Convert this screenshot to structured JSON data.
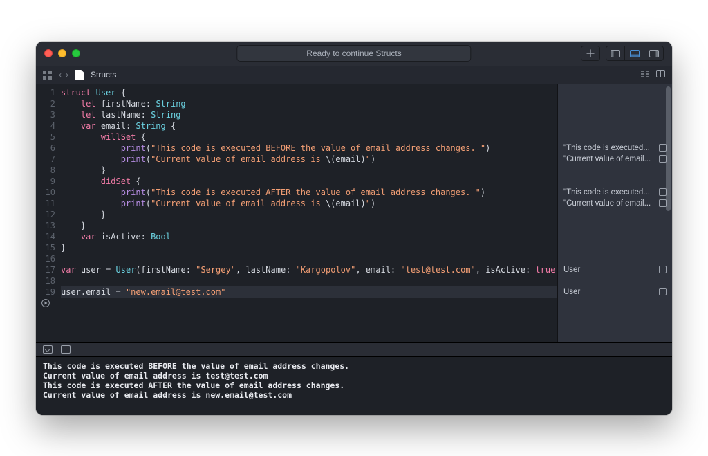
{
  "title": "Ready to continue Structs",
  "filename": "Structs",
  "code": {
    "lines": [
      {
        "n": 1,
        "tokens": [
          [
            "kw",
            "struct"
          ],
          [
            " "
          ],
          [
            "type",
            "User"
          ],
          [
            " "
          ],
          [
            "punc",
            "{"
          ]
        ]
      },
      {
        "n": 2,
        "tokens": [
          [
            "    "
          ],
          [
            "kw",
            "let"
          ],
          [
            " "
          ],
          [
            "ident",
            "firstName"
          ],
          [
            "punc",
            ": "
          ],
          [
            "type",
            "String"
          ]
        ]
      },
      {
        "n": 3,
        "tokens": [
          [
            "    "
          ],
          [
            "kw",
            "let"
          ],
          [
            " "
          ],
          [
            "ident",
            "lastName"
          ],
          [
            "punc",
            ": "
          ],
          [
            "type",
            "String"
          ]
        ]
      },
      {
        "n": 4,
        "tokens": [
          [
            "    "
          ],
          [
            "kw",
            "var"
          ],
          [
            " "
          ],
          [
            "ident",
            "email"
          ],
          [
            "punc",
            ": "
          ],
          [
            "type",
            "String"
          ],
          [
            " "
          ],
          [
            "punc",
            "{"
          ]
        ]
      },
      {
        "n": 5,
        "tokens": [
          [
            "        "
          ],
          [
            "kw",
            "willSet"
          ],
          [
            " "
          ],
          [
            "punc",
            "{"
          ]
        ]
      },
      {
        "n": 6,
        "tokens": [
          [
            "            "
          ],
          [
            "fn",
            "print"
          ],
          [
            "paren",
            "("
          ],
          [
            "str",
            "\"This code is executed BEFORE the value of email address changes. \""
          ],
          [
            "paren",
            ")"
          ]
        ]
      },
      {
        "n": 7,
        "tokens": [
          [
            "            "
          ],
          [
            "fn",
            "print"
          ],
          [
            "paren",
            "("
          ],
          [
            "str",
            "\"Current value of email address is "
          ],
          [
            "interp",
            "\\("
          ],
          [
            "ident",
            "email"
          ],
          [
            "interp",
            ")"
          ],
          [
            "str",
            "\""
          ],
          [
            "paren",
            ")"
          ]
        ]
      },
      {
        "n": 8,
        "tokens": [
          [
            "        "
          ],
          [
            "punc",
            "}"
          ]
        ]
      },
      {
        "n": 9,
        "tokens": [
          [
            "        "
          ],
          [
            "kw",
            "didSet"
          ],
          [
            " "
          ],
          [
            "punc",
            "{"
          ]
        ]
      },
      {
        "n": 10,
        "tokens": [
          [
            "            "
          ],
          [
            "fn",
            "print"
          ],
          [
            "paren",
            "("
          ],
          [
            "str",
            "\"This code is executed AFTER the value of email address changes. \""
          ],
          [
            "paren",
            ")"
          ]
        ]
      },
      {
        "n": 11,
        "tokens": [
          [
            "            "
          ],
          [
            "fn",
            "print"
          ],
          [
            "paren",
            "("
          ],
          [
            "str",
            "\"Current value of email address is "
          ],
          [
            "interp",
            "\\("
          ],
          [
            "ident",
            "email"
          ],
          [
            "interp",
            ")"
          ],
          [
            "str",
            "\""
          ],
          [
            "paren",
            ")"
          ]
        ]
      },
      {
        "n": 12,
        "tokens": [
          [
            "        "
          ],
          [
            "punc",
            "}"
          ]
        ]
      },
      {
        "n": 13,
        "tokens": [
          [
            "    "
          ],
          [
            "punc",
            "}"
          ]
        ]
      },
      {
        "n": 14,
        "tokens": [
          [
            "    "
          ],
          [
            "kw",
            "var"
          ],
          [
            " "
          ],
          [
            "ident",
            "isActive"
          ],
          [
            "punc",
            ": "
          ],
          [
            "type",
            "Bool"
          ]
        ]
      },
      {
        "n": 15,
        "tokens": [
          [
            "punc",
            "}"
          ]
        ]
      },
      {
        "n": 16,
        "tokens": [
          [
            ""
          ]
        ]
      },
      {
        "n": 17,
        "tokens": [
          [
            "kw",
            "var"
          ],
          [
            " "
          ],
          [
            "ident",
            "user"
          ],
          [
            " = "
          ],
          [
            "type",
            "User"
          ],
          [
            "paren",
            "("
          ],
          [
            "ident",
            "firstName"
          ],
          [
            "punc",
            ": "
          ],
          [
            "str",
            "\"Sergey\""
          ],
          [
            "punc",
            ", "
          ],
          [
            "ident",
            "lastName"
          ],
          [
            "punc",
            ": "
          ],
          [
            "str",
            "\"Kargopolov\""
          ],
          [
            "punc",
            ", "
          ],
          [
            "ident",
            "email"
          ],
          [
            "punc",
            ": "
          ],
          [
            "str",
            "\"test@test.com\""
          ],
          [
            "punc",
            ", "
          ],
          [
            "ident",
            "isActive"
          ],
          [
            "punc",
            ": "
          ],
          [
            "bool",
            "true"
          ],
          [
            "paren",
            ")"
          ]
        ]
      },
      {
        "n": 18,
        "tokens": [
          [
            ""
          ]
        ]
      },
      {
        "n": 19,
        "hl": true,
        "tokens": [
          [
            "ident",
            "user"
          ],
          [
            "punc",
            "."
          ],
          [
            "ident",
            "email"
          ],
          [
            " = "
          ],
          [
            "str",
            "\"new.email@test.com\""
          ]
        ]
      }
    ]
  },
  "results": [
    {
      "line": 6,
      "text": "\"This code is executed..."
    },
    {
      "line": 7,
      "text": "\"Current value of email..."
    },
    {
      "line": 10,
      "text": "\"This code is executed..."
    },
    {
      "line": 11,
      "text": "\"Current value of email..."
    },
    {
      "line": 17,
      "text": "User"
    },
    {
      "line": 19,
      "text": "User"
    }
  ],
  "console": [
    "This code is executed BEFORE the value of email address changes.",
    "Current value of email address is test@test.com",
    "This code is executed AFTER the value of email address changes.",
    "Current value of email address is new.email@test.com"
  ]
}
